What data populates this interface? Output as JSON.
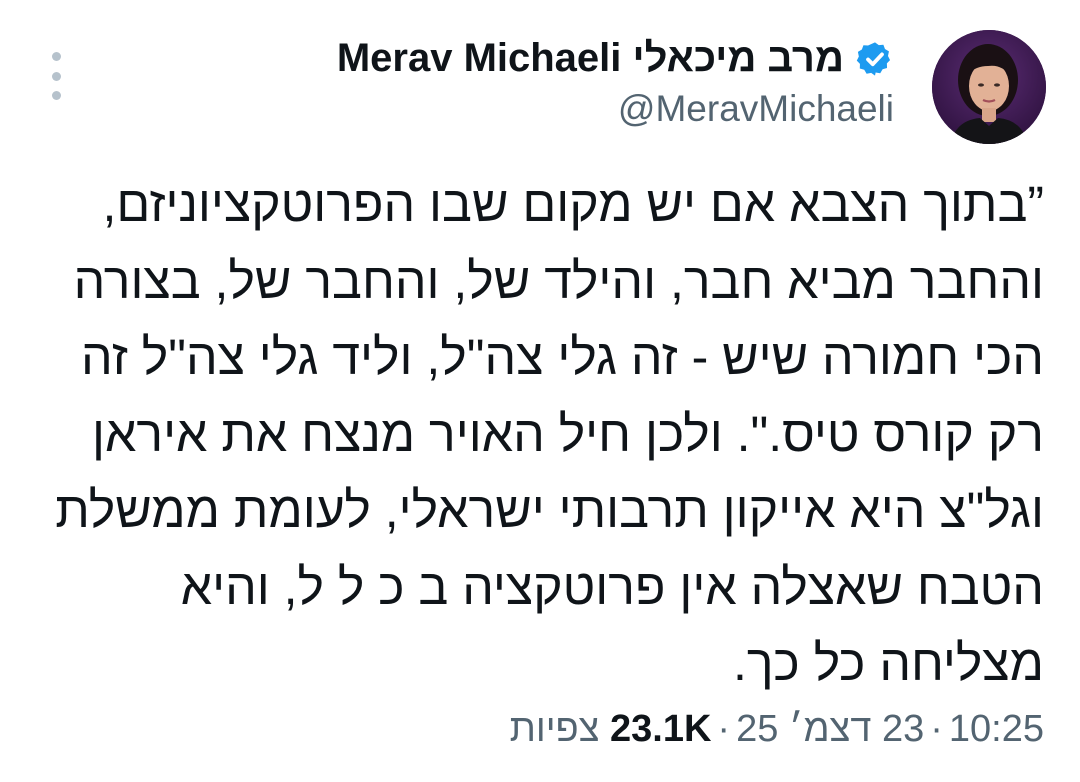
{
  "author": {
    "display_name": "Merav Michaeli מרב מיכאלי",
    "handle": "@MeravMichaeli",
    "verified_icon": "verified-badge-icon",
    "accent_color": "#1d9bf0"
  },
  "tweet": {
    "lines": [
      "”בתוך הצבא אם יש מקום שבו הפרוטקציוניזם,",
      "והחבר מביא חבר, והילד של, והחבר של, בצורה",
      "הכי חמורה שיש - זה גלי צה\"ל, וליד גלי צה\"ל זה",
      "רק קורס טיס.\". ולכן חיל האויר מנצח את איראן",
      "וגל\"צ היא אייקון תרבותי ישראלי, לעומת ממשלת",
      "הטבח שאצלה אין פרוטקציה ב כ ל ל, והיא",
      "מצליחה כל כך."
    ]
  },
  "meta": {
    "time": "10:25",
    "separator": "·",
    "date": "23 דצמ׳ 25",
    "views_count": "23.1K",
    "views_label": "צפיות"
  },
  "actions": {
    "more_icon": "more-vertical-icon"
  }
}
